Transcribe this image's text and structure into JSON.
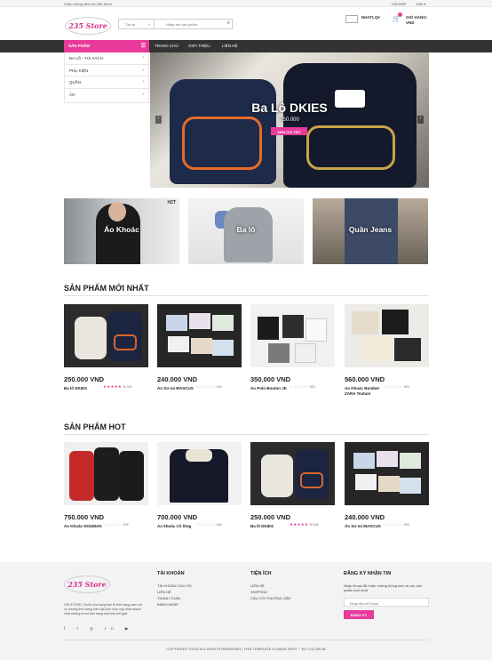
{
  "topbar": {
    "welcome": "Chào mừng đến với 235 Store",
    "help": "HỎI ĐÁP",
    "currency": "VND ▾"
  },
  "header": {
    "logo": "235 Store",
    "search_category": "Tất cả",
    "search_placeholder": "Nhập tên sản phẩm",
    "lang": "NHATLQ▾",
    "cart_label_1": "GIỎ HÀNG:",
    "cart_label_2": "VND"
  },
  "nav": {
    "products": "SẢN PHẨM",
    "home": "TRANG CHỦ",
    "about": "GIỚI THIỆU",
    "contact": "LIÊN HỆ"
  },
  "sidebar": {
    "items": [
      {
        "label": "BA LÔ - TÚI XÁCH"
      },
      {
        "label": "PHỤ KIỆN"
      },
      {
        "label": "QUẦN"
      },
      {
        "label": "ÁO"
      }
    ]
  },
  "hero": {
    "title": "Ba Lô DKIES",
    "price": "250.000",
    "button": "XEM CHI TIẾT"
  },
  "banners": [
    {
      "label": "Áo Khoác"
    },
    {
      "label": "Ba lô"
    },
    {
      "label": "Quần Jeans"
    }
  ],
  "banner_tag": "H2T",
  "newest": {
    "title": "SẢN PHẨM MỚI NHẤT",
    "products": [
      {
        "price": "250.000 VND",
        "name": "Ba lô DKIES",
        "rating": "5.0/5",
        "stars": 5
      },
      {
        "price": "240.000 VND",
        "name": "Áo Sơ mi MASCUS",
        "rating": "0/5",
        "stars": 0
      },
      {
        "price": "350.000 VND",
        "name": "Áo Polo Bouton JK",
        "rating": "0/5",
        "stars": 0
      },
      {
        "price": "560.000 VND",
        "name": "Áo Khoác Bomber ZARA Texture",
        "rating": "0/5",
        "stars": 0
      }
    ]
  },
  "hot": {
    "title": "SẢN PHẨM HOT",
    "products": [
      {
        "price": "750.000 VND",
        "name": "Áo Khoác NOUMAN",
        "rating": "0/5",
        "stars": 0
      },
      {
        "price": "700.000 VND",
        "name": "Áo khoác Cổ lông",
        "rating": "0/5",
        "stars": 0
      },
      {
        "price": "250.000 VND",
        "name": "Ba lô DKIES",
        "rating": "5.0/5",
        "stars": 5
      },
      {
        "price": "240.000 VND",
        "name": "Áo Sơ mi MASCUS",
        "rating": "0/5",
        "stars": 0
      }
    ]
  },
  "footer": {
    "logo": "235 Store",
    "desc": "235 STORE: Chuỗi cửa hàng bán lẻ thời trang nam với xu hướng thời trang hiện đại luôn luôn cập nhật nhanh nhất những trend thời trang mới trên thế giới.",
    "social": "f  t  ◎  in  ▶",
    "account_title": "TÀI KHOẢN",
    "account_links": [
      "TÀI KHOẢN CỦA TÔI",
      "LIÊN HỆ",
      "THANH TOÁN",
      "ĐĂNG NHẬP"
    ],
    "util_title": "TIỆN ÍCH",
    "util_links": [
      "LIÊN HỆ",
      "SHIPPING",
      "CÂU HỎI THƯỜNG GẶP"
    ],
    "news_title": "ĐĂNG KÝ NHẬN TIN",
    "news_desc": "Nhập Email để nhận những thông báo về các sản phẩm mới nhất",
    "news_placeholder": "Nhập địa chỉ Email",
    "news_button": "ĐĂNG KÝ",
    "copyright": "COPYRIGHT ©2021 ALL RIGHTS RESERVED | THIS TEMPLATE IS MADE WITH ♡ BY COLORLIB"
  },
  "colors": {
    "accent": "#e83a9a",
    "nav_bg": "#333333"
  }
}
